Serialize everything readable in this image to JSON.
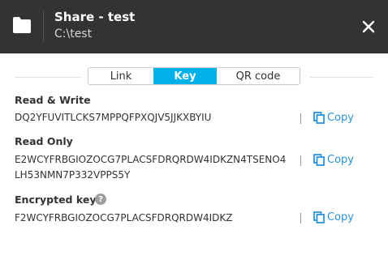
{
  "header": {
    "title": "Share - test",
    "path": "C:\\test"
  },
  "tabs": [
    {
      "label": "Link",
      "active": false
    },
    {
      "label": "Key",
      "active": true
    },
    {
      "label": "QR code",
      "active": false
    }
  ],
  "keys": {
    "read_write": {
      "label": "Read & Write",
      "value": "DQ2YFUVITLCKS7MPPQFPXQJV5JJKXBYIU"
    },
    "read_only": {
      "label": "Read Only",
      "value_line1": "E2WCYFRBGIOZOCG7PLACSFDRQRDW4IDKZN4TSENO4",
      "value_line2": "LH53NMN7P332VPPS5Y"
    },
    "encrypted": {
      "label": "Encrypted key",
      "help_glyph": "?",
      "value": "F2WCYFRBGIOZOCG7PLACSFDRQRDW4IDKZ"
    }
  },
  "copy_label": "Copy",
  "colors": {
    "header_bg": "#333333",
    "accent": "#00b0e8",
    "copy_link": "#2d93d6"
  }
}
